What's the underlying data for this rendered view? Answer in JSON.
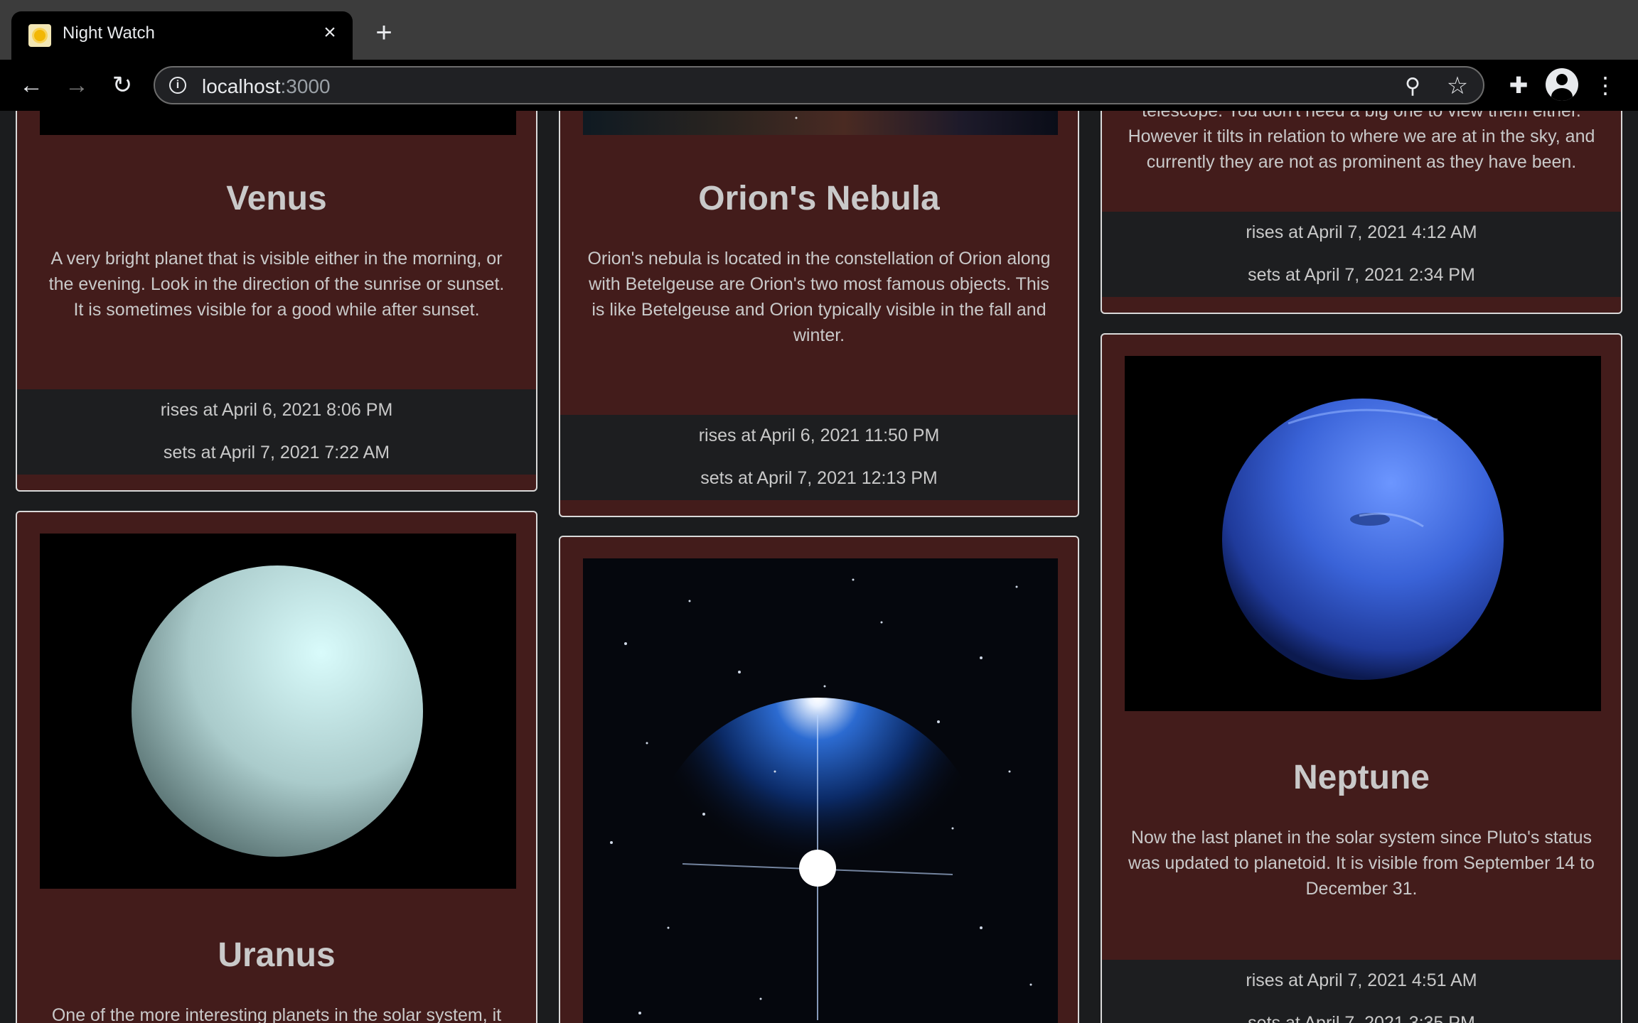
{
  "browser": {
    "tab_title": "Night Watch",
    "url_host": "localhost",
    "url_port": ":3000"
  },
  "cards": {
    "venus": {
      "title": "Venus",
      "description": "A very bright planet that is visible either in the morning, or the evening. Look in the direction of the sunrise or sunset. It is sometimes visible for a good while after sunset.",
      "rises": "rises at April 6, 2021 8:06 PM",
      "sets": "sets at April 7, 2021 7:22 AM"
    },
    "orion_nebula": {
      "title": "Orion's Nebula",
      "description": "Orion's nebula is located in the constellation of Orion along with Betelgeuse are Orion's two most famous objects. This is like Betelgeuse and Orion typically visible in the fall and winter.",
      "rises": "rises at April 6, 2021 11:50 PM",
      "sets": "sets at April 7, 2021 12:13 PM"
    },
    "saturn_partial": {
      "description_partial": "telescope. You don't need a big one to view them either. However it tilts in relation to where we are at in the sky, and currently they are not as prominent as they have been.",
      "rises": "rises at April 7, 2021 4:12 AM",
      "sets": "sets at April 7, 2021 2:34 PM"
    },
    "neptune": {
      "title": "Neptune",
      "description": "Now the last planet in the solar system since Pluto's status was updated to planetoid. It is visible from September 14 to December 31.",
      "rises": "rises at April 7, 2021 4:51 AM",
      "sets": "sets at April 7, 2021 3:35 PM"
    },
    "uranus": {
      "title": "Uranus",
      "description_partial": "One of the more interesting planets in the solar system, it"
    }
  },
  "colors": {
    "card_bg": "#431c1b",
    "footer_bg": "#1d1e20",
    "page_bg": "#1b1c1e",
    "text": "#c9c9c9"
  }
}
